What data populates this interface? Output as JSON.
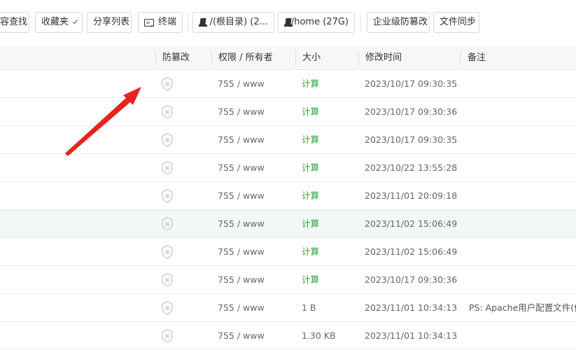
{
  "toolbar": {
    "buttons": [
      {
        "label": "容查找"
      },
      {
        "label": "收藏夹"
      },
      {
        "label": "分享列表"
      },
      {
        "label": "终端"
      },
      {
        "label": "/(根目录) (2..."
      },
      {
        "label": "/home (27G)"
      },
      {
        "label": "企业级防篡改"
      },
      {
        "label": "文件同步"
      }
    ]
  },
  "table": {
    "headers": {
      "tamper": "防篡改",
      "perm": "权限 / 所有者",
      "size": "大小",
      "mtime": "修改时间",
      "note": "备注"
    },
    "rows": [
      {
        "perm": "755 / www",
        "size": "计算",
        "mtime": "2023/10/17 09:30:35",
        "note": ""
      },
      {
        "perm": "755 / www",
        "size": "计算",
        "mtime": "2023/10/17 09:30:36",
        "note": ""
      },
      {
        "perm": "755 / www",
        "size": "计算",
        "mtime": "2023/10/17 09:30:35",
        "note": ""
      },
      {
        "perm": "755 / www",
        "size": "计算",
        "mtime": "2023/10/22 13:55:28",
        "note": ""
      },
      {
        "perm": "755 / www",
        "size": "计算",
        "mtime": "2023/11/01 20:09:18",
        "note": ""
      },
      {
        "perm": "755 / www",
        "size": "计算",
        "mtime": "2023/11/02 15:06:49",
        "note": ""
      },
      {
        "perm": "755 / www",
        "size": "计算",
        "mtime": "2023/11/02 15:06:49",
        "note": ""
      },
      {
        "perm": "755 / www",
        "size": "计算",
        "mtime": "2023/10/17 09:30:36",
        "note": ""
      },
      {
        "perm": "755 / www",
        "size": "1 B",
        "mtime": "2023/11/01 10:34:13",
        "note": "PS: Apache用户配置文件(伪"
      },
      {
        "perm": "755 / www",
        "size": "1.30 KB",
        "mtime": "2023/11/01 10:34:13",
        "note": ""
      }
    ]
  },
  "colors": {
    "calc_link": "#20a53a",
    "arrow": "#e6231e",
    "row_highlight": "#f2f8f4"
  },
  "icons": {
    "tamper": "shield-x-icon",
    "terminal": "terminal-icon",
    "disk": "disk-icon",
    "dropdown": "chevron-down-icon"
  }
}
